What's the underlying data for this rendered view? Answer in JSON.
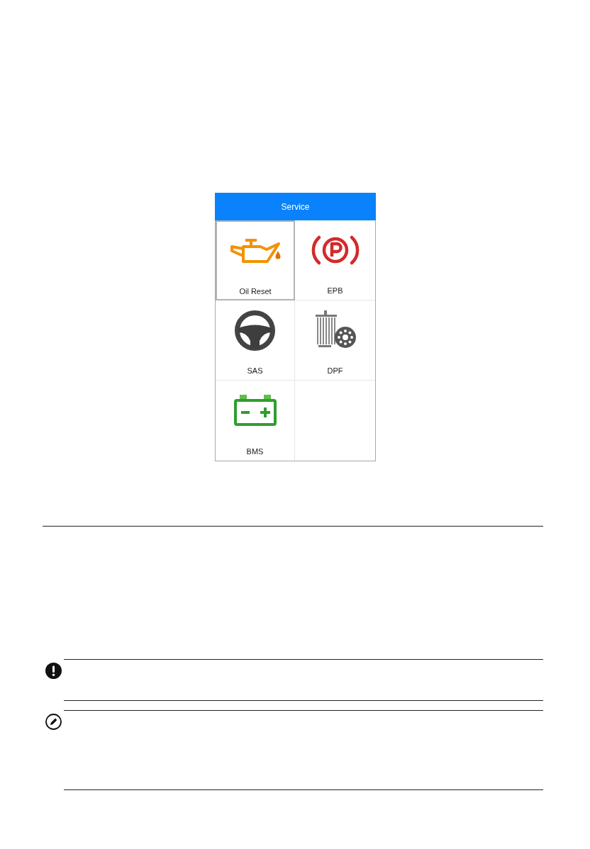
{
  "screen": {
    "title": "Service",
    "tiles": [
      {
        "label": "Oil Reset",
        "kind": "oil",
        "selected": true
      },
      {
        "label": "EPB",
        "kind": "epb",
        "selected": false
      },
      {
        "label": "SAS",
        "kind": "sas",
        "selected": false
      },
      {
        "label": "DPF",
        "kind": "dpf",
        "selected": false
      },
      {
        "label": "BMS",
        "kind": "bms",
        "selected": false
      }
    ]
  },
  "notes": [
    {
      "kind": "important"
    },
    {
      "kind": "note"
    }
  ]
}
